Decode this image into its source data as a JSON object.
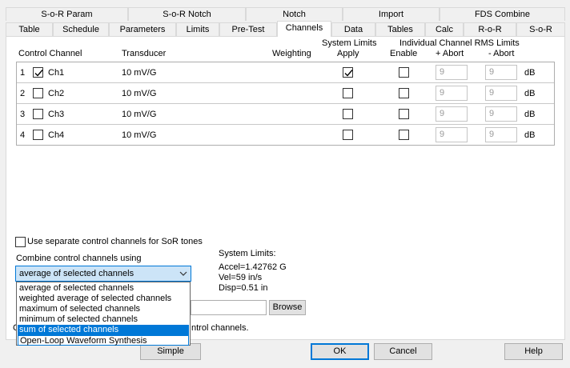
{
  "tabs_row1": [
    "S-o-R Param",
    "S-o-R Notch",
    "Notch",
    "Import",
    "FDS Combine"
  ],
  "tabs_row2": [
    "Table",
    "Schedule",
    "Parameters",
    "Limits",
    "Pre-Test",
    "Channels",
    "Data",
    "Tables",
    "Calc",
    "R-o-R",
    "S-o-R"
  ],
  "active_tab": "Channels",
  "headers": {
    "control_channel": "Control Channel",
    "transducer": "Transducer",
    "weighting": "Weighting",
    "system_limits": "System Limits",
    "apply": "Apply",
    "individual_rms": "Individual Channel RMS Limits",
    "enable": "Enable",
    "plus_abort": "+ Abort",
    "minus_abort": "- Abort"
  },
  "channels": [
    {
      "index": "1",
      "name": "Ch1",
      "checked": true,
      "transducer": "10 mV/G",
      "apply": true,
      "enable": false,
      "plus_abort": "9",
      "minus_abort": "9",
      "unit": "dB"
    },
    {
      "index": "2",
      "name": "Ch2",
      "checked": false,
      "transducer": "10 mV/G",
      "apply": false,
      "enable": false,
      "plus_abort": "9",
      "minus_abort": "9",
      "unit": "dB"
    },
    {
      "index": "3",
      "name": "Ch3",
      "checked": false,
      "transducer": "10 mV/G",
      "apply": false,
      "enable": false,
      "plus_abort": "9",
      "minus_abort": "9",
      "unit": "dB"
    },
    {
      "index": "4",
      "name": "Ch4",
      "checked": false,
      "transducer": "10 mV/G",
      "apply": false,
      "enable": false,
      "plus_abort": "9",
      "minus_abort": "9",
      "unit": "dB"
    }
  ],
  "separate_control_label": "Use separate control channels for SoR tones",
  "combine_label": "Combine control channels using",
  "combine_selected": "average of selected channels",
  "combine_options": [
    "average of selected channels",
    "weighted average of selected channels",
    "maximum of selected channels",
    "minimum of selected channels",
    "sum of selected channels",
    "Open-Loop Waveform Synthesis"
  ],
  "combine_highlighted": "sum of selected channels",
  "system_limits": {
    "title": "System Limits:",
    "accel": "Accel=1.42762 G",
    "vel": "Vel=59 in/s",
    "disp": "Disp=0.51 in"
  },
  "browse_label": "Browse",
  "partial_text": "C",
  "partial_text_right": "ntrol channels.",
  "buttons": {
    "simple": "Simple",
    "ok": "OK",
    "cancel": "Cancel",
    "help": "Help"
  },
  "colors": {
    "accent": "#0078d7",
    "check": "#000000"
  }
}
